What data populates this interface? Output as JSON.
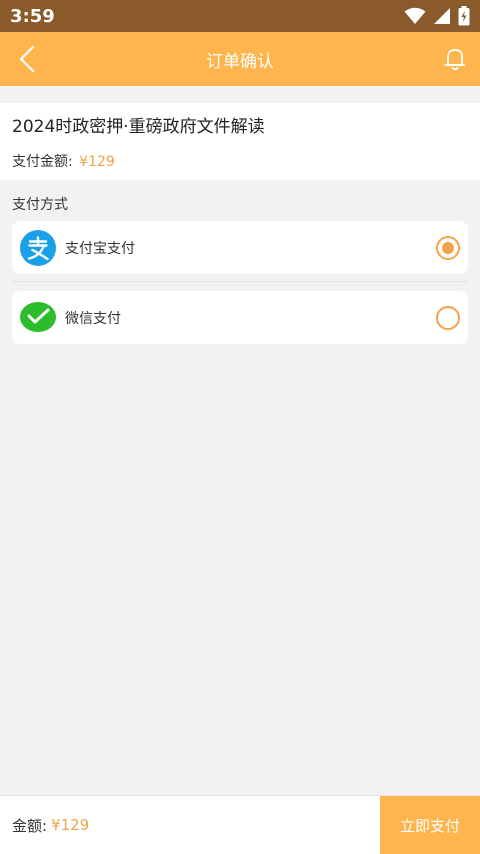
{
  "status_bar": {
    "time": "3:59"
  },
  "header": {
    "title": "订单确认"
  },
  "order": {
    "product_title": "2024时政密押·重磅政府文件解读",
    "amount_label": "支付金额:",
    "amount_value": "¥129"
  },
  "payment": {
    "section_title": "支付方式",
    "options": [
      {
        "label": "支付宝支付",
        "icon": "alipay-icon",
        "selected": true
      },
      {
        "label": "微信支付",
        "icon": "wechat-pay-icon",
        "selected": false
      }
    ]
  },
  "footer": {
    "total_label": "金额:",
    "total_value": "¥129",
    "pay_button_label": "立即支付"
  },
  "colors": {
    "accent": "#ffb54d",
    "price": "#f5a24a",
    "alipay": "#1aa0e8",
    "wechat": "#2bbd2b"
  }
}
